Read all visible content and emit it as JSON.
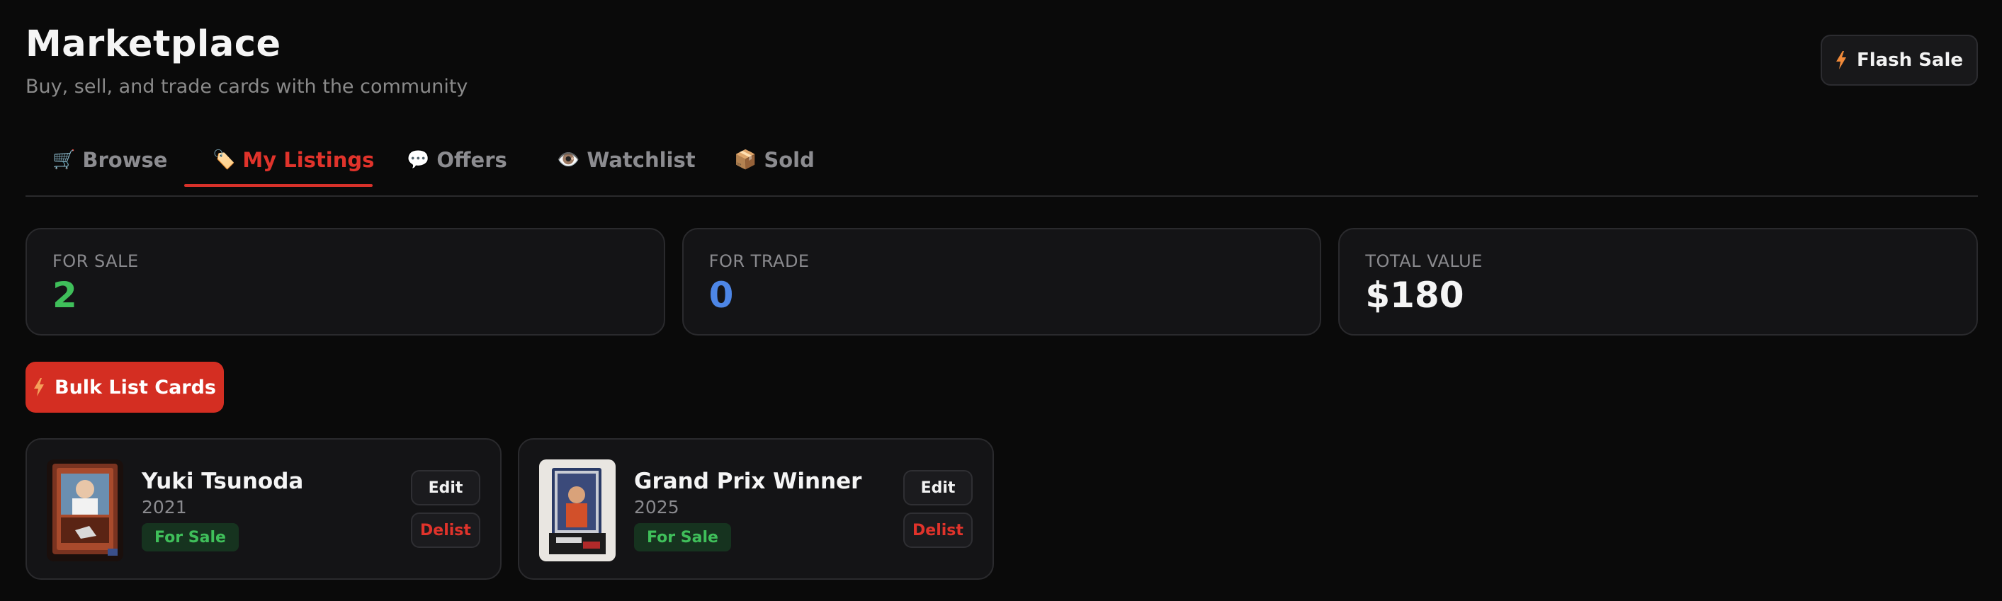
{
  "header": {
    "title": "Marketplace",
    "subtitle": "Buy, sell, and trade cards with the community",
    "flash_sale_label": "Flash Sale"
  },
  "tabs": [
    {
      "icon": "🛒",
      "icon_name": "cart-icon",
      "label": "Browse",
      "active": false
    },
    {
      "icon": "🏷️",
      "icon_name": "tag-icon",
      "label": "My Listings",
      "active": true
    },
    {
      "icon": "💬",
      "icon_name": "speech-bubble-icon",
      "label": "Offers",
      "active": false
    },
    {
      "icon": "👁️",
      "icon_name": "eye-icon",
      "label": "Watchlist",
      "active": false
    },
    {
      "icon": "📦",
      "icon_name": "package-icon",
      "label": "Sold",
      "active": false
    }
  ],
  "stats": [
    {
      "label": "FOR SALE",
      "value": "2",
      "color": "#3fbf5a"
    },
    {
      "label": "FOR TRADE",
      "value": "0",
      "color": "#4d86e6"
    },
    {
      "label": "TOTAL VALUE",
      "value": "$180",
      "color": "#f5f5f5"
    }
  ],
  "bulk_button_label": "Bulk List Cards",
  "listings": [
    {
      "name": "Yuki Tsunoda",
      "year": "2021",
      "status": "For Sale",
      "edit_label": "Edit",
      "delist_label": "Delist"
    },
    {
      "name": "Grand Prix Winner",
      "year": "2025",
      "status": "For Sale",
      "edit_label": "Edit",
      "delist_label": "Delist"
    }
  ],
  "colors": {
    "accent": "#d42e22",
    "background": "#0a0a0a",
    "card": "#141416",
    "success": "#3fbf5a",
    "info": "#4d86e6"
  }
}
